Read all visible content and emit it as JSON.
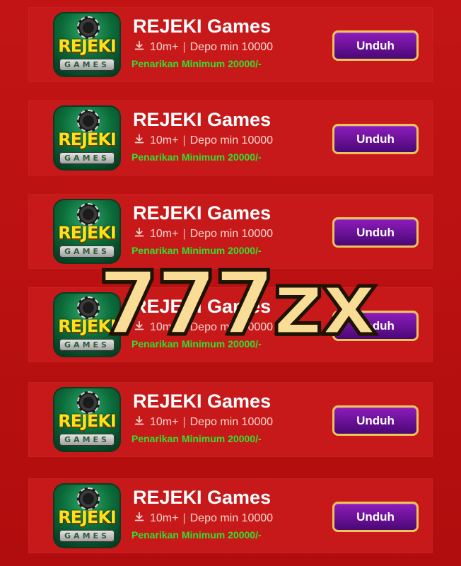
{
  "apps": [
    {
      "title": "REJEKI Games",
      "downloads": "10m+",
      "separator": "|",
      "deposit": "Depo min 10000",
      "withdrawal": "Penarikan Minimum 20000/-",
      "button_label": "Unduh",
      "icon_name": "rejeki-games-app-icon",
      "logo_text": "REJEKI",
      "logo_subtext": "GAMES"
    },
    {
      "title": "REJEKI Games",
      "downloads": "10m+",
      "separator": "|",
      "deposit": "Depo min 10000",
      "withdrawal": "Penarikan Minimum 20000/-",
      "button_label": "Unduh",
      "icon_name": "rejeki-games-app-icon",
      "logo_text": "REJEKI",
      "logo_subtext": "GAMES"
    },
    {
      "title": "REJEKI Games",
      "downloads": "10m+",
      "separator": "|",
      "deposit": "Depo min 10000",
      "withdrawal": "Penarikan Minimum 20000/-",
      "button_label": "Unduh",
      "icon_name": "rejeki-games-app-icon",
      "logo_text": "REJEKI",
      "logo_subtext": "GAMES"
    },
    {
      "title": "REJEKI Games",
      "downloads": "10m+",
      "separator": "|",
      "deposit": "Depo min 10000",
      "withdrawal": "Penarikan Minimum 20000/-",
      "button_label": "Unduh",
      "icon_name": "rejeki-games-app-icon",
      "logo_text": "REJEKI",
      "logo_subtext": "GAMES"
    },
    {
      "title": "REJEKI Games",
      "downloads": "10m+",
      "separator": "|",
      "deposit": "Depo min 10000",
      "withdrawal": "Penarikan Minimum 20000/-",
      "button_label": "Unduh",
      "icon_name": "rejeki-games-app-icon",
      "logo_text": "REJEKI",
      "logo_subtext": "GAMES"
    },
    {
      "title": "REJEKI Games",
      "downloads": "10m+",
      "separator": "|",
      "deposit": "Depo min 10000",
      "withdrawal": "Penarikan Minimum 20000/-",
      "button_label": "Unduh",
      "icon_name": "rejeki-games-app-icon",
      "logo_text": "REJEKI",
      "logo_subtext": "GAMES"
    }
  ],
  "watermark": {
    "text": "777zx"
  },
  "colors": {
    "background": "#b70f10",
    "card": "#c7191a",
    "button_purple": "#6a0f9b",
    "button_border": "#efc25b",
    "withdraw_green": "#33e12f",
    "watermark_fill": "#f9dd96"
  }
}
